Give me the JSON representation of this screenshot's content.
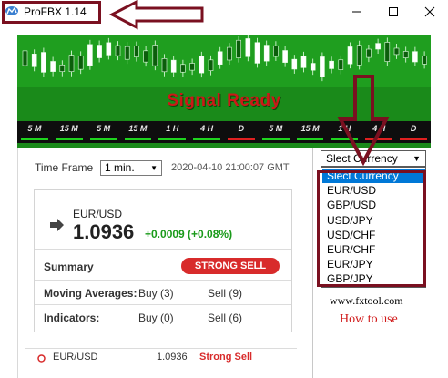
{
  "window": {
    "title": "ProFBX 1.14",
    "icon": "app-logo-icon",
    "controls": [
      "minimize-icon",
      "maximize-icon",
      "close-icon"
    ]
  },
  "banner": {
    "signal_text": "Signal Ready",
    "timeframes": [
      {
        "label": "5 M",
        "status_color": "#1fd41f"
      },
      {
        "label": "15 M",
        "status_color": "#1fd41f"
      },
      {
        "label": "5 M",
        "status_color": "#1fd41f"
      },
      {
        "label": "15 M",
        "status_color": "#1fd41f"
      },
      {
        "label": "1 H",
        "status_color": "#1fd41f"
      },
      {
        "label": "4 H",
        "status_color": "#1fd41f"
      },
      {
        "label": "D",
        "status_color": "#e02020"
      },
      {
        "label": "5 M",
        "status_color": "#1fd41f"
      },
      {
        "label": "15 M",
        "status_color": "#1fd41f"
      },
      {
        "label": "1 H",
        "status_color": "#1fd41f"
      },
      {
        "label": "4 H",
        "status_color": "#e02020"
      },
      {
        "label": "D",
        "status_color": "#e02020"
      }
    ]
  },
  "widget": {
    "time_frame_label": "Time Frame",
    "time_frame_value": "1 min.",
    "datetime": "2020-04-10 21:00:07 GMT",
    "pair": "EUR/USD",
    "price": "1.0936",
    "change": "+0.0009 (+0.08%)",
    "summary_label": "Summary",
    "summary_signal": "STRONG SELL",
    "moving_averages_label": "Moving Averages:",
    "moving_averages_buy": "Buy (3)",
    "moving_averages_sell": "Sell (9)",
    "indicators_label": "Indicators:",
    "indicators_buy": "Buy (0)",
    "indicators_sell": "Sell (6)",
    "bottom_pair": "EUR/USD",
    "bottom_price": "1.0936",
    "bottom_signal": "Strong Sell"
  },
  "currency": {
    "selected": "Slect Currency",
    "options": [
      "Slect Currency",
      "EUR/USD",
      "GBP/USD",
      "USD/JPY",
      "USD/CHF",
      "EUR/CHF",
      "EUR/JPY",
      "GBP/JPY"
    ],
    "highlighted_index": 0
  },
  "links": {
    "website": "www.fxtool.com",
    "how_to_use": "How to use"
  },
  "colors": {
    "annotation": "#7a1020",
    "banner_green": "#1a8a1a",
    "signal_red": "#cc1818",
    "sell_red": "#d82b2b",
    "highlight_blue": "#0078d7"
  }
}
